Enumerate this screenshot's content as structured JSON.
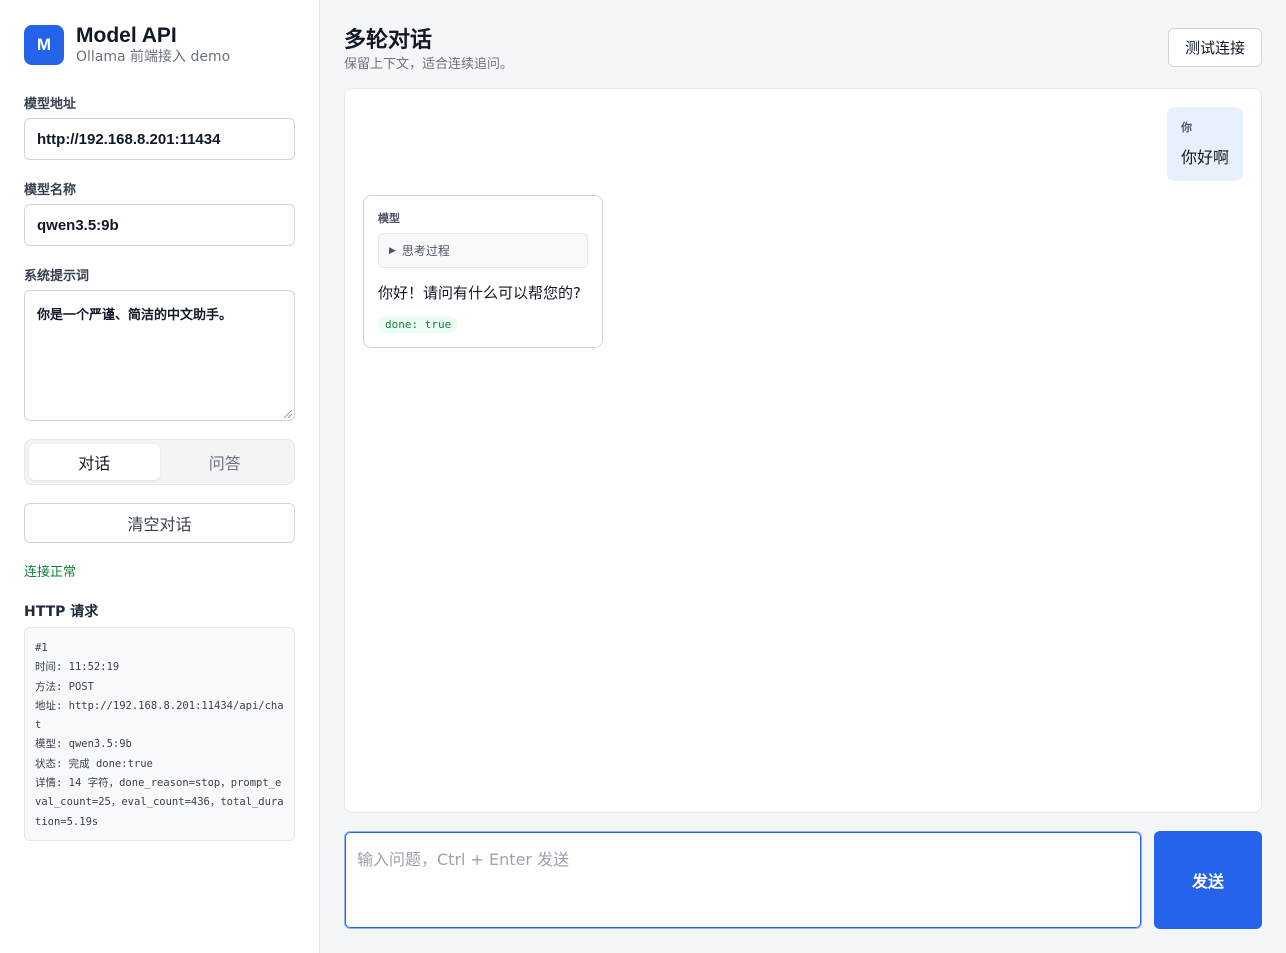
{
  "brand": {
    "logo_letter": "M",
    "title": "Model API",
    "subtitle": "Ollama 前端接入 demo"
  },
  "form": {
    "model_url_label": "模型地址",
    "model_url_value": "http://192.168.8.201:11434",
    "model_name_label": "模型名称",
    "model_name_value": "qwen3.5:9b",
    "system_prompt_label": "系统提示词",
    "system_prompt_value": "你是一个严谨、简洁的中文助手。"
  },
  "mode_tabs": [
    {
      "label": "对话",
      "active": true
    },
    {
      "label": "问答",
      "active": false
    }
  ],
  "clear_button": "清空对话",
  "connection_status": "连接正常",
  "http_panel": {
    "title": "HTTP 请求",
    "lines": [
      "#1",
      "时间: 11:52:19",
      "方法: POST",
      "地址: http://192.168.8.201:11434/api/chat",
      "模型: qwen3.5:9b",
      "状态: 完成 done:true",
      "详情: 14 字符，done_reason=stop，prompt_eval_count=25，eval_count=436，total_duration=5.19s"
    ]
  },
  "header": {
    "title": "多轮对话",
    "subtitle": "保留上下文，适合连续追问。",
    "test_button": "测试连接"
  },
  "messages": {
    "user": {
      "role": "你",
      "text": "你好啊"
    },
    "model": {
      "role": "模型",
      "thinking_label": "思考过程",
      "text": "你好！请问有什么可以帮您的?",
      "badge": "done: true"
    }
  },
  "composer": {
    "placeholder": "输入问题，Ctrl + Enter 发送",
    "send_label": "发送"
  },
  "colors": {
    "accent": "#2563eb",
    "success": "#15803d",
    "user_bubble": "#e8f0fe"
  }
}
